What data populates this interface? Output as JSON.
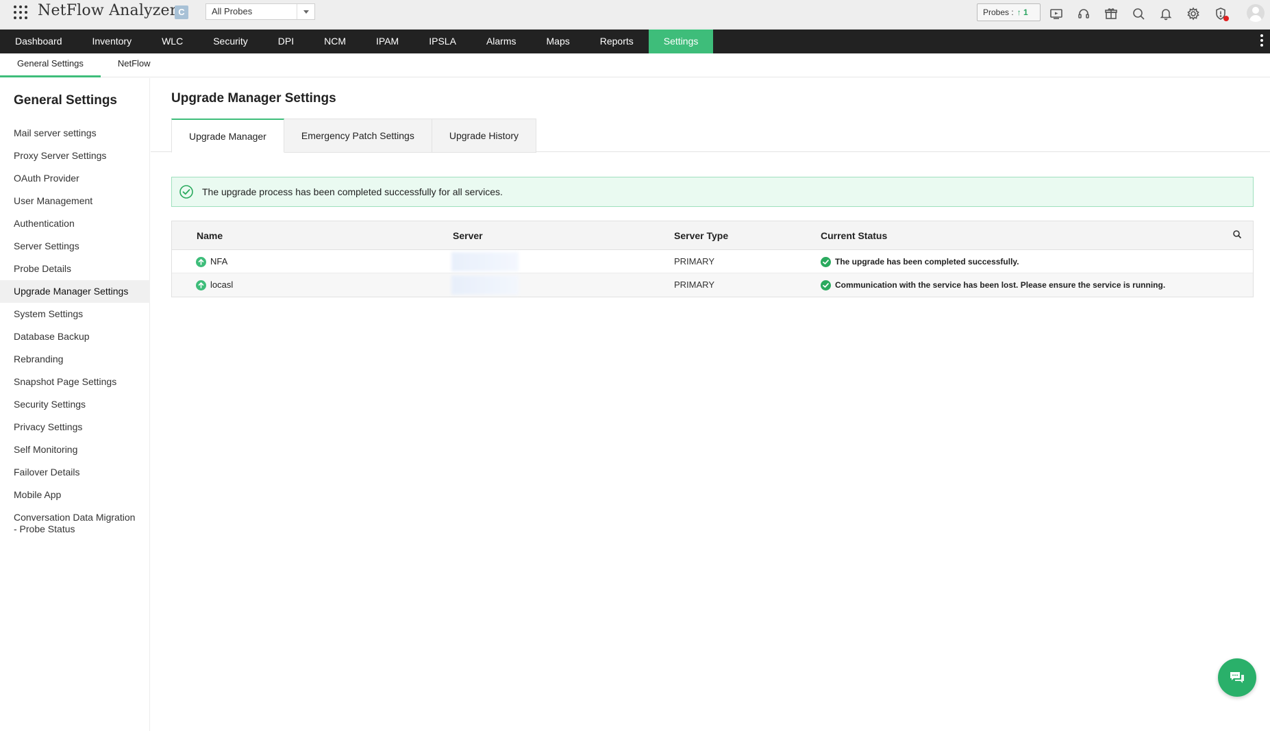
{
  "header": {
    "app_title": "NetFlow Analyzer",
    "edition_badge": "C",
    "probe_selector": "All Probes",
    "probes_label": "Probes :",
    "probes_up_count": "1",
    "icons": [
      "video-icon",
      "headset-icon",
      "gift-icon",
      "search-icon",
      "bell-icon",
      "gear-icon",
      "shield-alert-icon",
      "avatar"
    ]
  },
  "main_nav": {
    "items": [
      {
        "label": "Dashboard"
      },
      {
        "label": "Inventory"
      },
      {
        "label": "WLC"
      },
      {
        "label": "Security"
      },
      {
        "label": "DPI"
      },
      {
        "label": "NCM"
      },
      {
        "label": "IPAM"
      },
      {
        "label": "IPSLA"
      },
      {
        "label": "Alarms"
      },
      {
        "label": "Maps"
      },
      {
        "label": "Reports"
      },
      {
        "label": "Settings",
        "active": true
      }
    ]
  },
  "sub_nav": {
    "items": [
      {
        "label": "General Settings",
        "active": true
      },
      {
        "label": "NetFlow"
      }
    ]
  },
  "sidebar": {
    "title": "General Settings",
    "items": [
      {
        "label": "Mail server settings"
      },
      {
        "label": "Proxy Server Settings"
      },
      {
        "label": "OAuth Provider"
      },
      {
        "label": "User Management"
      },
      {
        "label": "Authentication"
      },
      {
        "label": "Server Settings"
      },
      {
        "label": "Probe Details"
      },
      {
        "label": "Upgrade Manager Settings",
        "active": true
      },
      {
        "label": "System Settings"
      },
      {
        "label": "Database Backup"
      },
      {
        "label": "Rebranding"
      },
      {
        "label": "Snapshot Page Settings"
      },
      {
        "label": "Security Settings"
      },
      {
        "label": "Privacy Settings"
      },
      {
        "label": "Self Monitoring"
      },
      {
        "label": "Failover Details"
      },
      {
        "label": "Mobile App"
      },
      {
        "label": "Conversation Data Migration - Probe Status"
      }
    ]
  },
  "main": {
    "page_title": "Upgrade Manager Settings",
    "tabs": [
      {
        "label": "Upgrade Manager",
        "active": true
      },
      {
        "label": "Emergency Patch Settings"
      },
      {
        "label": "Upgrade History"
      }
    ],
    "banner": "The upgrade process has been completed successfully for all services.",
    "table": {
      "columns": [
        "Name",
        "Server",
        "Server Type",
        "Current Status"
      ],
      "rows": [
        {
          "name": "NFA",
          "server": "",
          "server_type": "PRIMARY",
          "status": "The upgrade has been completed successfully."
        },
        {
          "name": "locasl",
          "server": "",
          "server_type": "PRIMARY",
          "status": "Communication with the service has been lost. Please ensure the service is running."
        }
      ]
    }
  },
  "colors": {
    "accent": "#3ebd7a",
    "nav_bg": "#222222",
    "banner_bg": "#eafaf1",
    "banner_border": "#9ee0bd"
  }
}
